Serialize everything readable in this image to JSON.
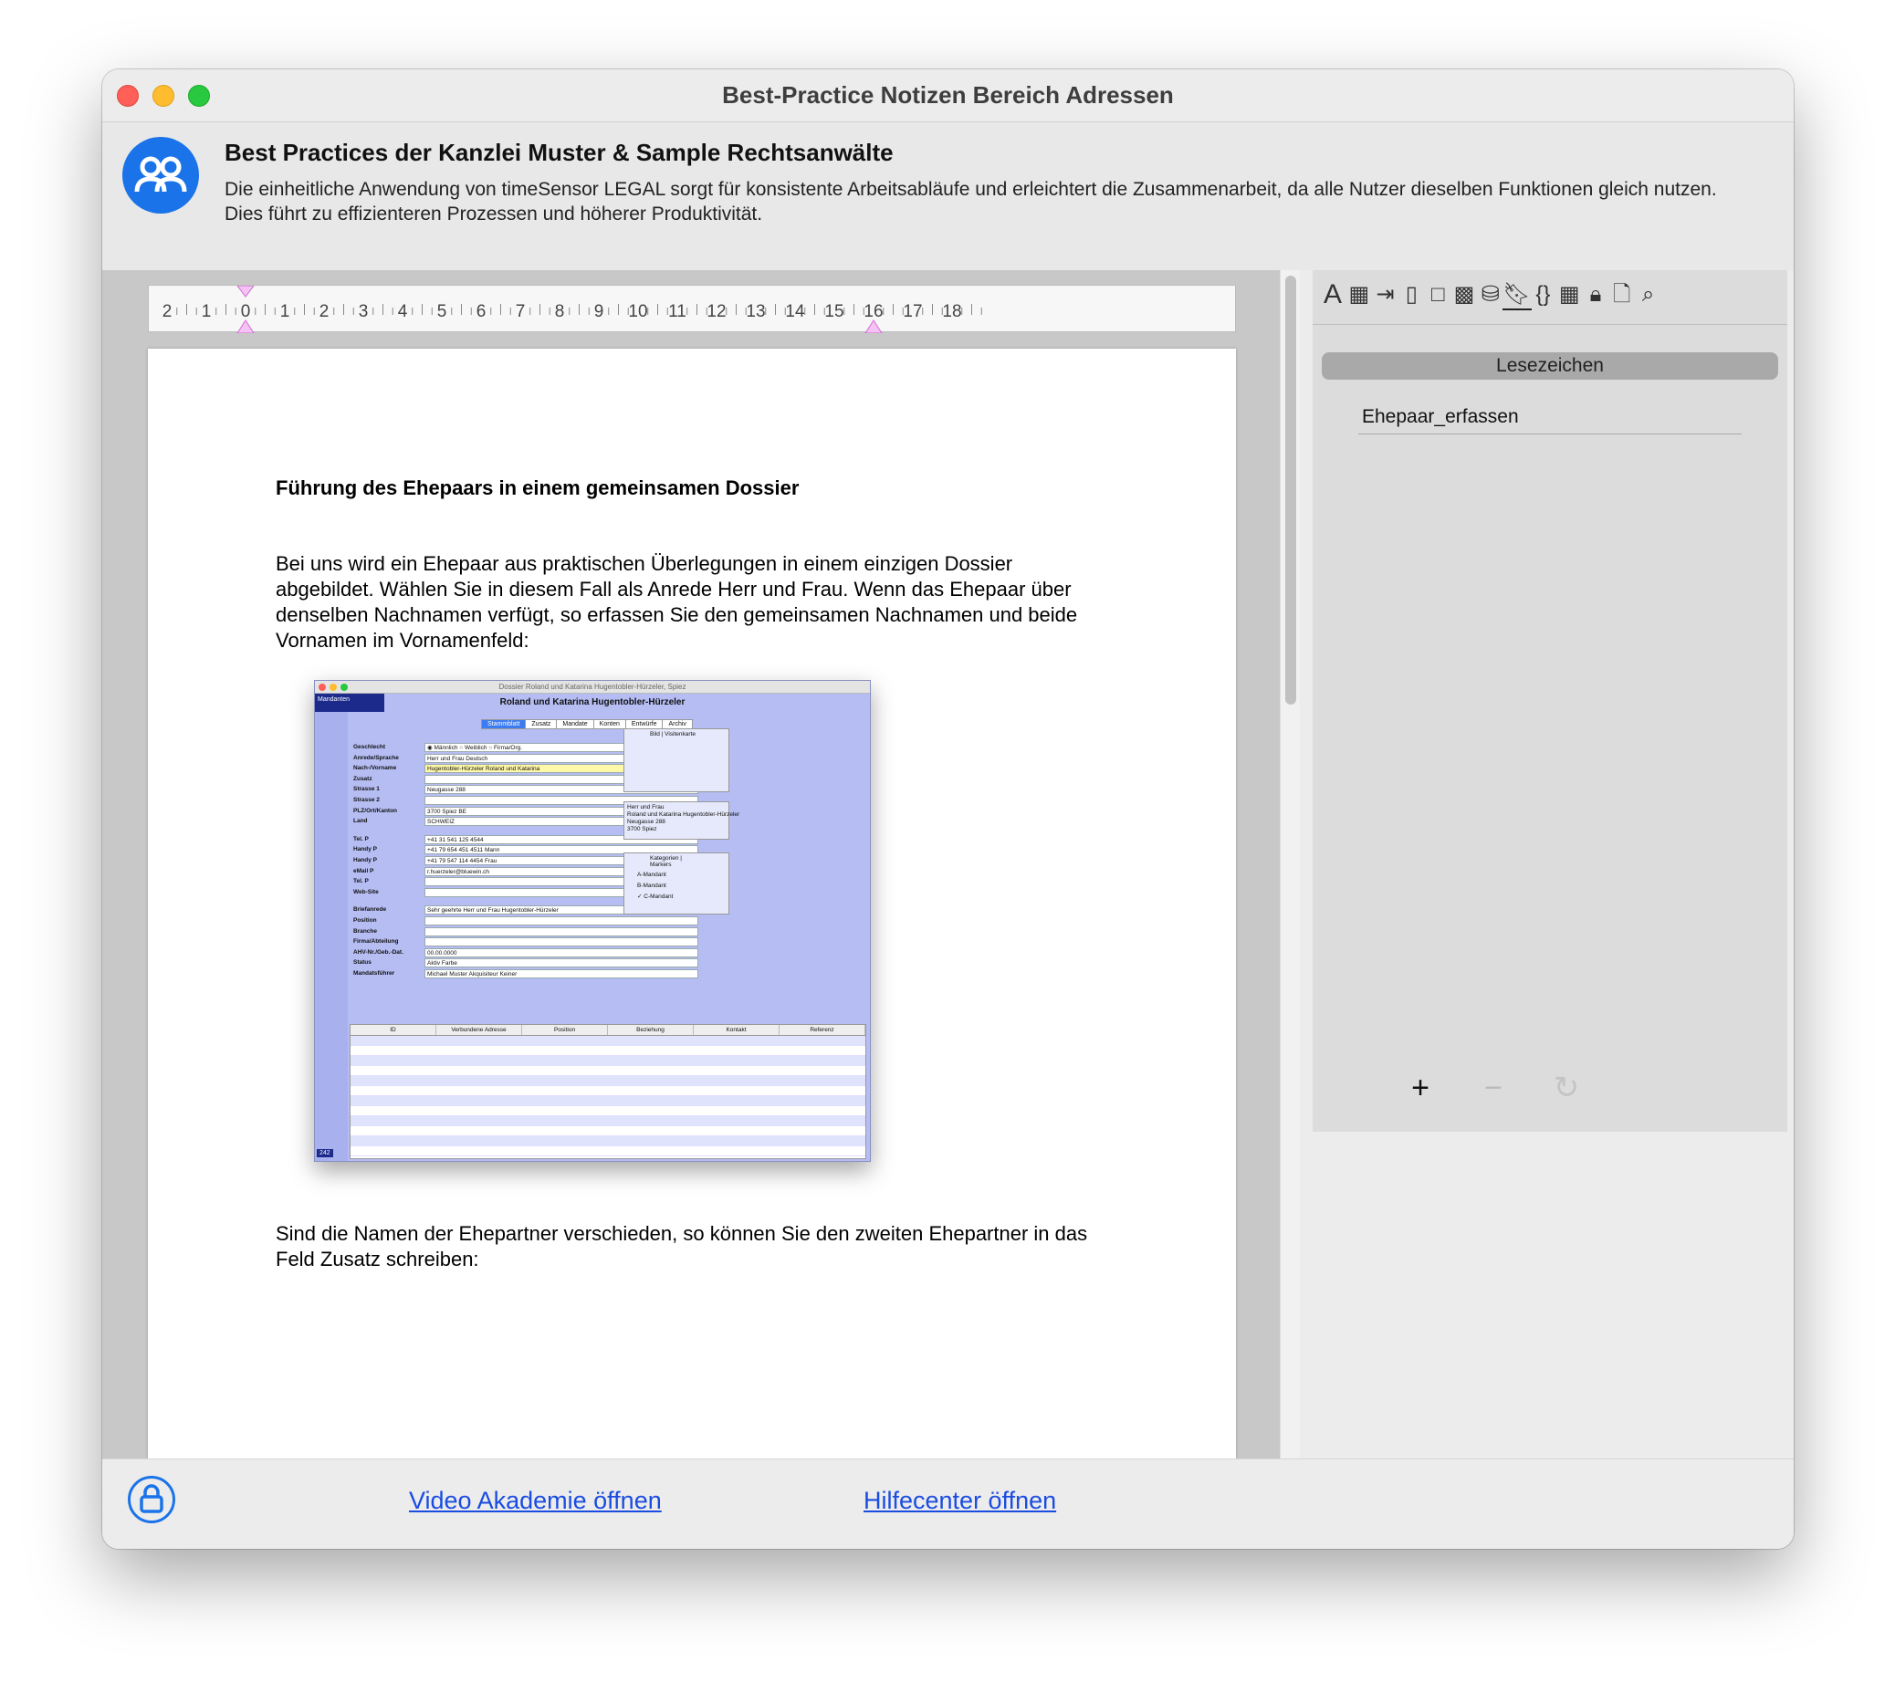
{
  "window": {
    "title": "Best-Practice Notizen Bereich Adressen"
  },
  "header": {
    "title": "Best Practices der Kanzlei Muster & Sample Rechtsanwälte",
    "description": "Die einheitliche Anwendung von timeSensor LEGAL sorgt für konsistente Arbeitsabläufe und erleichtert die Zusammenarbeit, da alle Nutzer dieselben Funktionen gleich nutzen. Dies führt zu effizienteren Prozessen und höherer Produktivität.",
    "icon": "users-icon"
  },
  "ruler": {
    "labels": [
      "2",
      "1",
      "0",
      "1",
      "2",
      "3",
      "4",
      "5",
      "6",
      "7",
      "8",
      "9",
      "10",
      "11",
      "12",
      "13",
      "14",
      "15",
      "16",
      "17",
      "18"
    ]
  },
  "document": {
    "heading": "Führung des Ehepaars in einem gemeinsamen Dossier",
    "paragraph1": "Bei uns wird ein Ehepaar aus praktischen Überlegungen in einem einzigen Dossier abgebildet. Wählen Sie in diesem Fall als Anrede Herr und Frau. Wenn das Ehepaar über denselben Nachnamen verfügt, so erfassen Sie den gemeinsamen Nachnamen und beide Vornamen im Vornamenfeld:",
    "paragraph2": "Sind die Namen der Ehepartner verschieden, so können Sie den zweiten Ehepartner in das Feld Zusatz schreiben:",
    "embedded_screenshot": {
      "window_title": "Dossier Roland und Katarina Hugentobler-Hürzeler, Spiez",
      "sidebar_label": "Mandanten",
      "record_name": "Roland und Katarina Hugentobler-Hürzeler",
      "tabs": [
        "Stammblatt",
        "Zusatz",
        "Mandate",
        "Konten",
        "Entwürfe",
        "Archiv"
      ],
      "gender_options": [
        "Männlich",
        "Weiblich",
        "Firma/Org."
      ],
      "fields": [
        {
          "label": "Geschlecht",
          "value": ""
        },
        {
          "label": "Anrede/Sprache",
          "value": "Herr und Frau"
        },
        {
          "label": "Nach-/Vorname",
          "value": "Hugentobler-Hürzeler"
        },
        {
          "label": "Zusatz",
          "value": ""
        },
        {
          "label": "Strasse 1",
          "value": "Neugasse 288"
        },
        {
          "label": "Strasse 2",
          "value": ""
        },
        {
          "label": "PLZ/Ort/Kanton",
          "value": "3700"
        },
        {
          "label": "Land",
          "value": "SCHWEIZ"
        }
      ],
      "language": "Deutsch",
      "first_names": "Roland und Katarina",
      "city": "Spiez",
      "canton": "BE",
      "contacts": [
        {
          "label": "Tel. P",
          "value": "+41 31 541 125 4544"
        },
        {
          "label": "Handy P",
          "value": "+41 79 654 451 4511 Mann"
        },
        {
          "label": "Handy P",
          "value": "+41 79 547 114 4454 Frau"
        },
        {
          "label": "eMail P",
          "value": "r.huerzeler@bluewin.ch"
        },
        {
          "label": "Tel. P",
          "value": ""
        },
        {
          "label": "Web-Site",
          "value": ""
        }
      ],
      "extra_fields": [
        {
          "label": "Briefanrede",
          "value": "Sehr geehrte Herr und Frau Hugentobler-Hürzeler"
        },
        {
          "label": "Position",
          "value": ""
        },
        {
          "label": "Branche",
          "value": ""
        },
        {
          "label": "Firma/Abteilung",
          "value": ""
        },
        {
          "label": "AHV-Nr./Geb.-Dat.",
          "value": "00.00.0000"
        },
        {
          "label": "Status",
          "value": "Aktiv"
        },
        {
          "label": "Mandatsführer",
          "value": "Michael Muster"
        }
      ],
      "farbe_label": "Farbe",
      "akquisiteur_label": "Akquisiteur",
      "akquisiteur_value": "Keiner",
      "picture_tabs": [
        "Bild",
        "Visitenkarte"
      ],
      "address_block": "Herr und Frau\nRoland und Katarina Hugentobler-Hürzeler\nNeugasse 288\n3700 Spiez",
      "category_tabs": [
        "Kategorien",
        "Markers"
      ],
      "categories": [
        "A-Mandant",
        "B-Mandant",
        "C-Mandant"
      ],
      "grid_headers": [
        "ID",
        "Verbundene Adresse",
        "Position",
        "Beziehung",
        "Kontakt",
        "Referenz"
      ],
      "footer_number": "242"
    }
  },
  "sidebar": {
    "toolbar_icons": [
      "font-icon",
      "frame-icon",
      "tab-icon",
      "ruler-icon",
      "box-icon",
      "pattern-icon",
      "database-icon",
      "bookmark-icon",
      "braces-icon",
      "table-icon",
      "lock-icon",
      "page-icon",
      "search-icon"
    ],
    "section_title": "Lesezeichen",
    "bookmarks": [
      "Ehepaar_erfassen"
    ],
    "add_symbol": "+",
    "remove_symbol": "−",
    "refresh_symbol": "↻"
  },
  "footer": {
    "video_link": "Video Akademie öffnen",
    "help_link": "Hilfecenter öffnen",
    "lock_icon": "lock-icon"
  },
  "colors": {
    "accent": "#1a73e8",
    "link": "#1a4ce0",
    "embedded_bg": "#b5bdf3"
  }
}
